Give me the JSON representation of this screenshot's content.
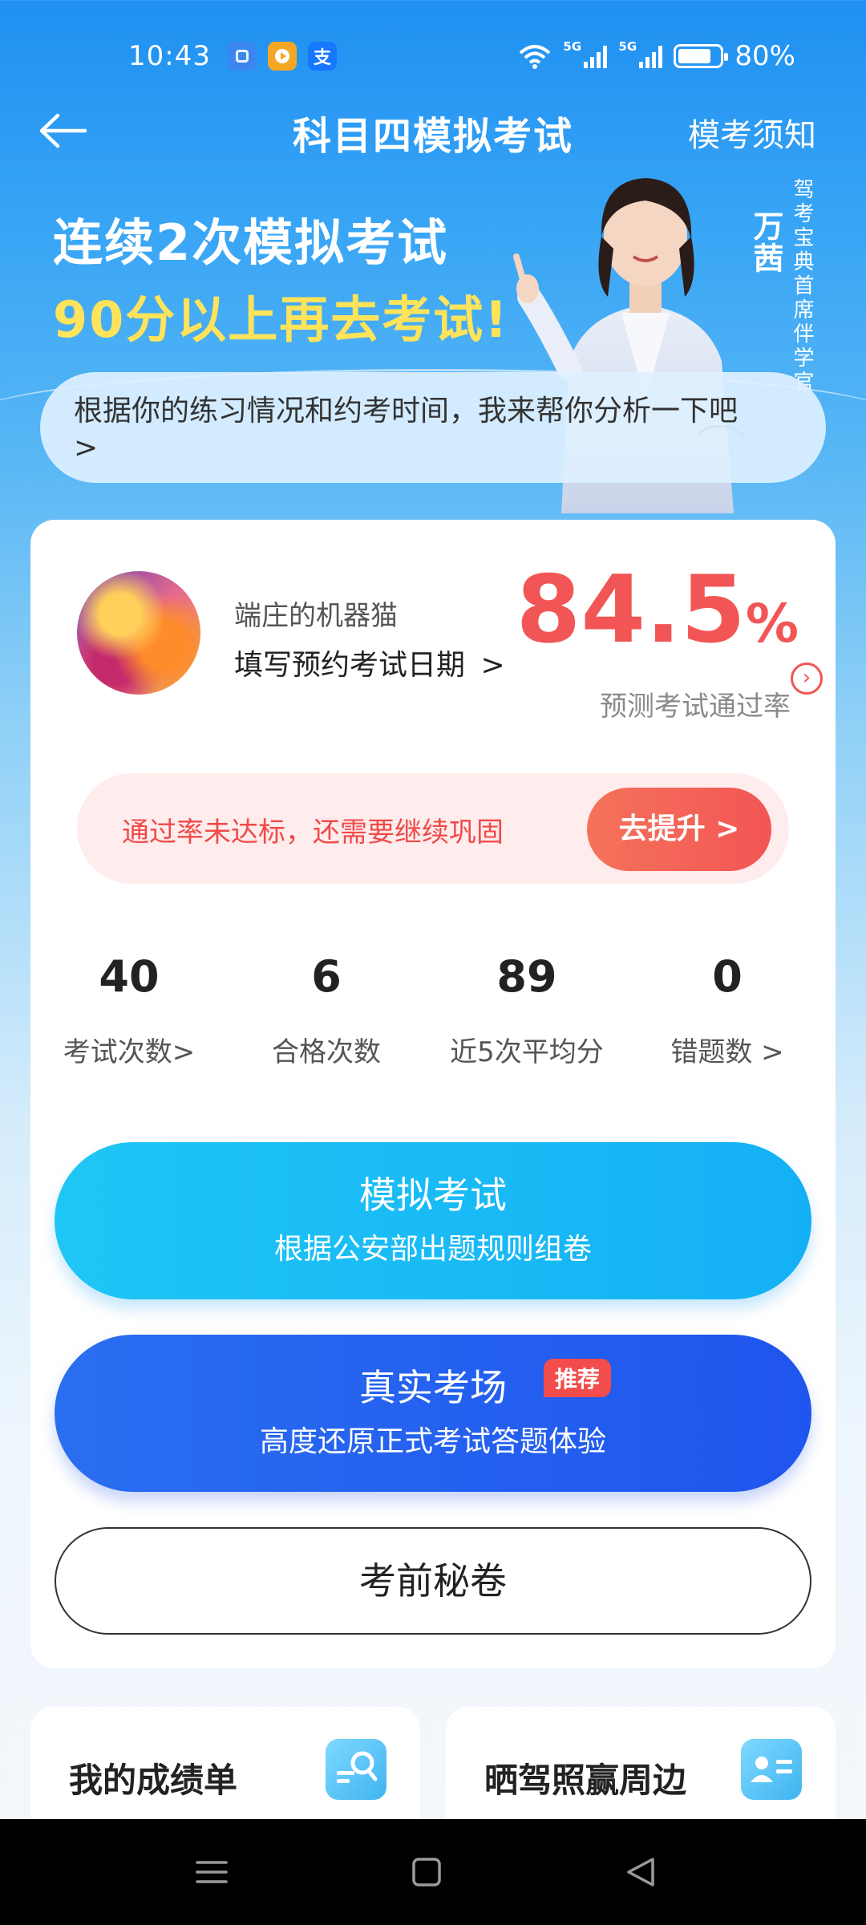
{
  "status_bar": {
    "time": "10:43",
    "battery": "80%",
    "battery_level": 0.8,
    "signal_label": "5G",
    "app_icons": [
      "note-app-icon",
      "video-app-icon",
      "alipay-icon"
    ]
  },
  "header": {
    "title": "科目四模拟考试",
    "right_link": "模考须知"
  },
  "banner": {
    "line1": "连续2次模拟考试",
    "line2": "90分以上再去考试!",
    "coach_name": "万茜",
    "coach_title": "驾考宝典首席伴学官",
    "bubble_text": "根据你的练习情况和约考时间，我来帮你分析一下吧",
    "bubble_arrow": ">"
  },
  "profile": {
    "username": "端庄的机器猫",
    "date_link": "填写预约考试日期",
    "date_arrow": ">"
  },
  "pass_rate": {
    "value": "84.5",
    "unit": "%",
    "label": "预测考试通过率"
  },
  "warning": {
    "text": "通过率未达标，还需要继续巩固",
    "button": "去提升 >"
  },
  "stats": [
    {
      "value": "40",
      "label": "考试次数>"
    },
    {
      "value": "6",
      "label": "合格次数"
    },
    {
      "value": "89",
      "label": "近5次平均分"
    },
    {
      "value": "0",
      "label": "错题数 >"
    }
  ],
  "buttons": {
    "mock_title": "模拟考试",
    "mock_sub": "根据公安部出题规则组卷",
    "real_title": "真实考场",
    "real_tag": "推荐",
    "real_sub": "高度还原正式考试答题体验",
    "secret": "考前秘卷"
  },
  "tiles": [
    {
      "label": "我的成绩单",
      "icon": "search-report-icon"
    },
    {
      "label": "晒驾照赢周边",
      "icon": "id-card-icon"
    }
  ],
  "colors": {
    "accent_red": "#f25555",
    "accent_cyan": "#14b0f5",
    "accent_blue": "#1f55ee",
    "highlight_yellow": "#ffe35a"
  }
}
